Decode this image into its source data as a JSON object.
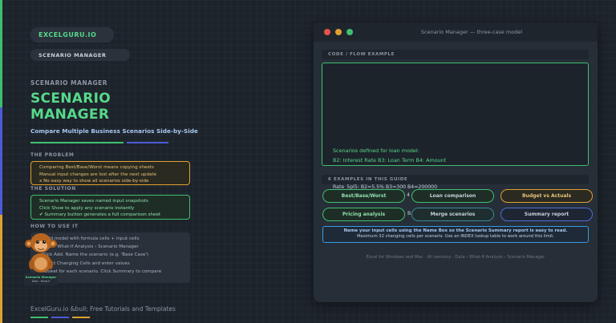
{
  "brand": "EXCELGURU.IO",
  "nav_badge": "SCENARIO MANAGER",
  "left": {
    "eyebrow": "SCENARIO MANAGER",
    "title_line1": "SCENARIO",
    "title_line2": "MANAGER",
    "subtitle": "Compare Multiple Business Scenarios Side-by-Side",
    "problem": {
      "label": "THE PROBLEM",
      "lines": [
        "Comparing Best/Base/Worst means copying sheets",
        "Manual input changes are lost after the next update",
        "x No easy way to show all scenarios side-by-side"
      ]
    },
    "solution": {
      "label": "THE SOLUTION",
      "lines": [
        "Scenario Manager saves named input snapshots",
        "Click Show to apply any scenario instantly",
        "✔ Summary button generates a full comparison sheet"
      ]
    },
    "howto": {
      "label": "HOW TO USE IT",
      "lines": [
        "Build model with formula cells + input cells",
        "Data › What-If Analysis › Scenario Manager",
        "Click Add. Name the scenario (e.g. 'Base Case')",
        "Select Changing Cells and enter values",
        "Repeat for each scenario. Click Summary to compare"
      ]
    },
    "mascot": {
      "caption": "Scenario Manager",
      "sub": "Data › What-If"
    },
    "footer": "ExcelGuru.io &bull; Free Tutorials and Templates"
  },
  "window": {
    "title": "Scenario Manager — three-case model",
    "code_label": "CODE / FLOW EXAMPLE",
    "code_lines": [
      "Scenarios defined for loan model:",
      "B2: Interest Rate B3: Loan Term B4: Amount"
    ],
    "overflow_text": "Rate_5pl5: B2=5.5% B3=300 B4=200000",
    "examples_label": "6 EXAMPLES IN THIS GUIDE",
    "buttons": [
      "Best/Base/Worst",
      "Loan comparison",
      "Budget vs Actuals",
      "Pricing analysis",
      "Merge scenarios",
      "Summary report"
    ],
    "behind_fragment_1": "4",
    "behind_fragment_2": "B",
    "tip_line1": "Name your input cells using the Name Box so the Scenario Summary report is easy to read.",
    "tip_line2": "Maximum 32 changing cells per scenario. Use an INDEX lookup table to work around this limit.",
    "footer": "Excel for Windows and Mac · All versions · Data › What-If Analysis › Scenario Manager"
  },
  "colors": {
    "green": "#56d98a",
    "orange": "#e0a030",
    "blue": "#5a6ee8",
    "bg": "#1d232b"
  }
}
